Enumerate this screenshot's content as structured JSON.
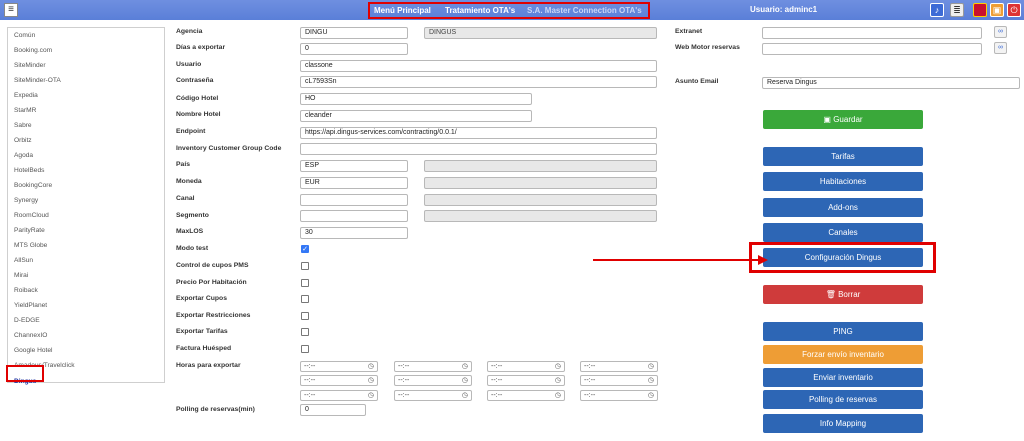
{
  "topbar": {
    "menu_principal": "Menú Principal",
    "tratamiento_ota": "Tratamiento OTA's",
    "master_connection": "S.A. Master Connection OTA's",
    "user": "Usuario: adminc1"
  },
  "sidebar": {
    "items": [
      "Común",
      "Booking.com",
      "SiteMinder",
      "SiteMinder-OTA",
      "Expedia",
      "StarMR",
      "Sabre",
      "Orbitz",
      "Agoda",
      "HotelBeds",
      "BookingCore",
      "Synergy",
      "RoomCloud",
      "ParityRate",
      "MTS Globe",
      "AllSun",
      "Mirai",
      "Roiback",
      "YieldPlanet",
      "D-EDGE",
      "ChannexIO",
      "Google Hotel",
      "Amadeus/Travelclick",
      "Dingus"
    ]
  },
  "form": {
    "agencia": {
      "label": "Agencia",
      "value": "DINGU",
      "name": "DINGUS"
    },
    "dias": {
      "label": "Días a exportar",
      "value": "0"
    },
    "usuario": {
      "label": "Usuario",
      "value": "classone"
    },
    "contrasena": {
      "label": "Contraseña",
      "value": "cL7593Sn"
    },
    "codigo_hotel": {
      "label": "Código Hotel",
      "value": "HO"
    },
    "nombre_hotel": {
      "label": "Nombre Hotel",
      "value": "cleander"
    },
    "endpoint": {
      "label": "Endpoint",
      "value": "https://api.dingus-services.com/contracting/0.0.1/"
    },
    "inventory_code": {
      "label": "Inventory Customer Group Code",
      "value": ""
    },
    "pais": {
      "label": "País",
      "value": "ESP"
    },
    "moneda": {
      "label": "Moneda",
      "value": "EUR"
    },
    "canal": {
      "label": "Canal",
      "value": ""
    },
    "segmento": {
      "label": "Segmento",
      "value": ""
    },
    "maxlos": {
      "label": "MaxLOS",
      "value": "30"
    },
    "modo_test": {
      "label": "Modo test",
      "checked": true
    },
    "control_cupos": {
      "label": "Control de cupos PMS",
      "checked": false
    },
    "precio_habitacion": {
      "label": "Precio Por Habitación",
      "checked": false
    },
    "exportar_cupos": {
      "label": "Exportar Cupos",
      "checked": false
    },
    "exportar_restricciones": {
      "label": "Exportar Restricciones",
      "checked": false
    },
    "exportar_tarifas": {
      "label": "Exportar Tarifas",
      "checked": false
    },
    "factura_huesped": {
      "label": "Factura Huésped",
      "checked": false
    },
    "horas_exportar": {
      "label": "Horas para exportar",
      "placeholder": "--:--"
    },
    "polling": {
      "label": "Polling de reservas(min)",
      "value": "0"
    },
    "extranet": {
      "label": "Extranet",
      "value": ""
    },
    "web_motor": {
      "label": "Web Motor reservas",
      "value": ""
    },
    "asunto_email": {
      "label": "Asunto Email",
      "value": "Reserva Dingus"
    }
  },
  "buttons": {
    "guardar": "Guardar",
    "tarifas": "Tarifas",
    "habitaciones": "Habitaciones",
    "addons": "Add-ons",
    "canales": "Canales",
    "configuracion": "Configuración Dingus",
    "borrar": "Borrar",
    "ping": "PING",
    "forzar": "Forzar envío inventario",
    "enviar": "Enviar inventario",
    "polling": "Polling de reservas",
    "info_mapping": "Info Mapping"
  },
  "colors": {
    "topbar": "#5a7fd8",
    "primary_button": "#2d66b5",
    "save_button": "#3aa83a",
    "delete_button": "#cf3b3b",
    "force_button": "#ee9d35",
    "highlight": "#e00000"
  }
}
